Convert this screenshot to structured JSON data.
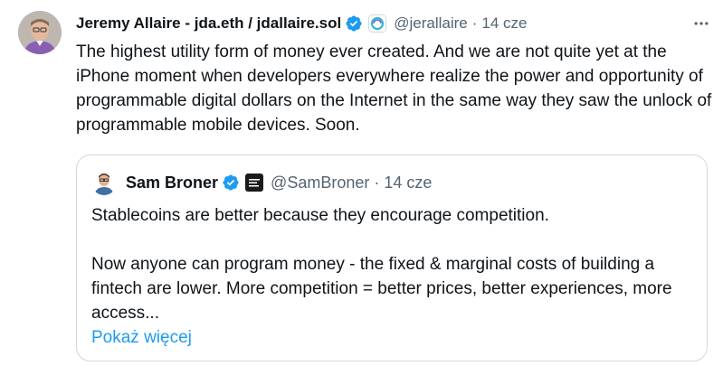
{
  "author": {
    "display_name": "Jeremy Allaire - jda.eth / jdallaire.sol",
    "handle": "@jerallaire",
    "separator": "·",
    "time": "14 cze",
    "verified": true,
    "avatar_icon": "profile-photo",
    "affiliate_icon": "circle-logo-badge"
  },
  "tweet_text": "The highest utility form of money ever created. And we are not quite yet at the iPhone moment when developers everywhere realize the power and opportunity of programmable digital dollars on the Internet in the same way they saw the unlock of programmable mobile devices. Soon.",
  "quoted": {
    "display_name": "Sam Broner",
    "handle": "@SamBroner",
    "separator": "·",
    "time": "14 cze",
    "verified": true,
    "paragraph_1": "Stablecoins are better because they encourage competition.",
    "paragraph_2": "Now anyone can program money - the fixed & marginal costs of building a fintech are lower. More competition = better prices, better experiences, more access...",
    "show_more_label": "Pokaż więcej"
  },
  "colors": {
    "text": "#0f1419",
    "secondary": "#536471",
    "accent": "#1d9bf0",
    "border": "#cfd9de"
  }
}
